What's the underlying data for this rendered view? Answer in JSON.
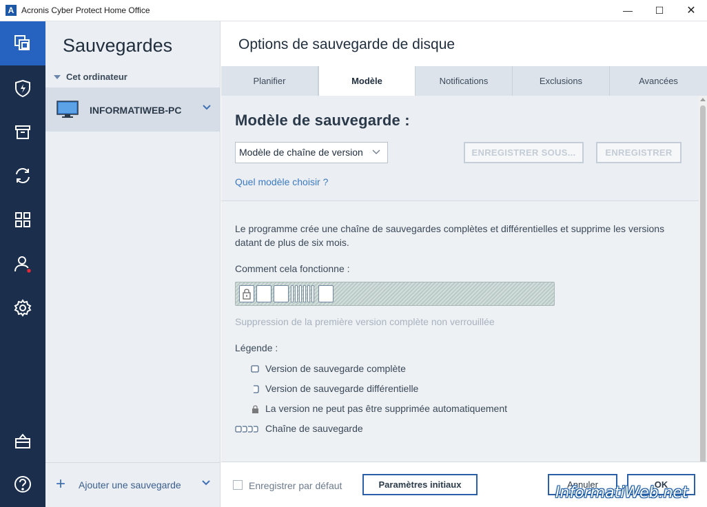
{
  "window": {
    "title": "Acronis Cyber Protect Home Office",
    "logo_letter": "A",
    "minimize": "—",
    "maximize": "☐",
    "close": "✕"
  },
  "rail": {
    "items": [
      {
        "icon": "backup-icon",
        "active": true
      },
      {
        "icon": "shield-bolt-icon"
      },
      {
        "icon": "archive-icon"
      },
      {
        "icon": "sync-icon"
      },
      {
        "icon": "tools-grid-icon"
      },
      {
        "icon": "account-icon",
        "badge": true
      },
      {
        "icon": "settings-gear-icon"
      },
      {
        "icon": "store-bag-icon"
      },
      {
        "icon": "help-icon"
      }
    ]
  },
  "sidebar": {
    "title": "Sauvegardes",
    "section_label": "Cet ordinateur",
    "machine_name": "INFORMATIWEB-PC",
    "add_backup_label": "Ajouter une sauvegarde"
  },
  "main": {
    "title": "Options de sauvegarde de disque",
    "tabs": [
      {
        "label": "Planifier"
      },
      {
        "label": "Modèle",
        "active": true
      },
      {
        "label": "Notifications"
      },
      {
        "label": "Exclusions"
      },
      {
        "label": "Avancées"
      }
    ],
    "scheme": {
      "heading": "Modèle de sauvegarde :",
      "selected": "Modèle de chaîne de version",
      "save_as_label": "ENREGISTRER SOUS...",
      "save_label": "ENREGISTRER",
      "help_link": "Quel modèle choisir ?"
    },
    "description": "Le programme crée une chaîne de sauvegardes complètes et différentielles et supprime les versions datant de plus de six mois.",
    "how_it_works_label": "Comment cela fonctionne :",
    "chain_caption": "Suppression de la première version complète non verrouillée",
    "legend": {
      "title": "Légende :",
      "items": [
        {
          "icon": "full-version-icon",
          "label": "Version de sauvegarde complète"
        },
        {
          "icon": "differential-version-icon",
          "label": "Version de sauvegarde différentielle"
        },
        {
          "icon": "lock-icon",
          "label": "La version ne peut pas être supprimée automatiquement"
        },
        {
          "icon": "chain-icon",
          "label": "Chaîne de sauvegarde"
        }
      ]
    }
  },
  "footer": {
    "default_checkbox_label": "Enregistrer par défaut",
    "default_checked": false,
    "initial_params_label": "Paramètres initiaux",
    "cancel_label": "Annuler",
    "ok_label": "OK"
  },
  "watermark": "InformatiWeb.net",
  "colors": {
    "rail_bg": "#1b2e4c",
    "rail_active": "#2663c0",
    "accent": "#2a5fa8",
    "link": "#3c7ac2"
  }
}
